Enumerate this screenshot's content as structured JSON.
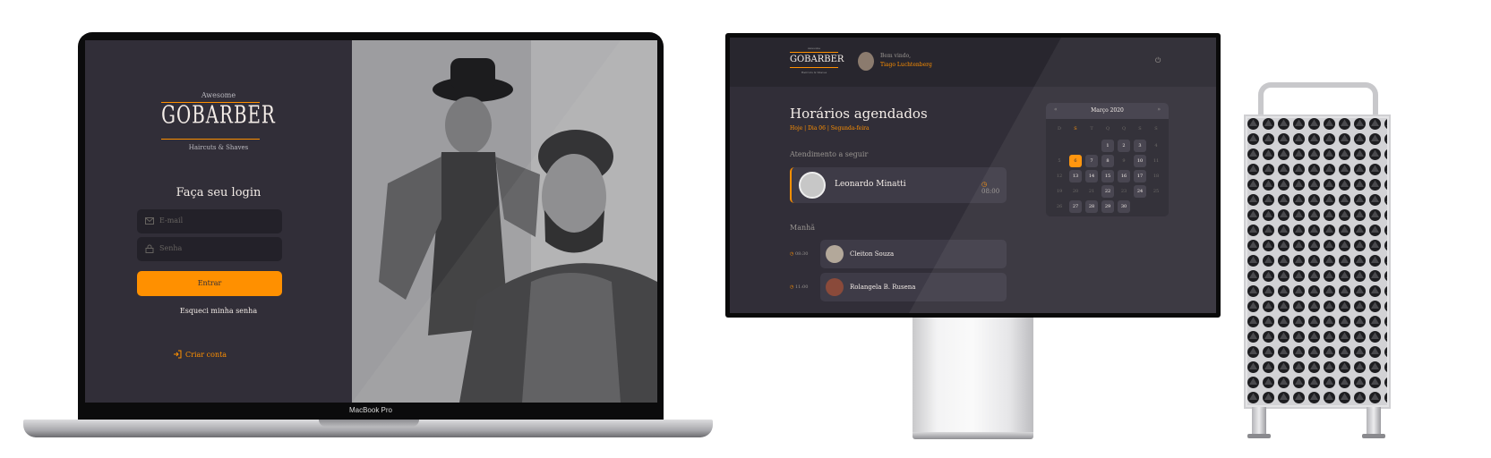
{
  "macbook": {
    "label": "MacBook Pro",
    "login": {
      "logo_top": "Awesome",
      "logo_name": "GOBARBER",
      "logo_sub": "Haircuts & Shaves",
      "title": "Faça seu login",
      "email_placeholder": "E-mail",
      "password_placeholder": "Senha",
      "submit_label": "Entrar",
      "forgot_label": "Esqueci minha senha",
      "create_label": "Criar conta"
    }
  },
  "monitor": {
    "header": {
      "logo_top": "Awesome",
      "logo_name": "GOBARBER",
      "logo_sub": "Haircuts & Shaves",
      "welcome": "Bem vindo,",
      "user_name": "Tiago Luchtenberg",
      "power_icon": "power-icon"
    },
    "title": "Horários agendados",
    "dates": "Hoje  |  Dia 06  |  Segunda-feira",
    "next_label": "Atendimento a seguir",
    "next": {
      "name": "Leonardo Minatti",
      "time": "08:00"
    },
    "morning_label": "Manhã",
    "appointments": [
      {
        "time": "08:30",
        "name": "Cleiton Souza"
      },
      {
        "time": "11:00",
        "name": "Rolangela B. Rusena"
      }
    ],
    "calendar": {
      "month": "Março 2020",
      "prev": "«",
      "next": "»",
      "weekdays": [
        "D",
        "S",
        "T",
        "Q",
        "Q",
        "S",
        "S"
      ],
      "weeks": [
        [
          "",
          "",
          "",
          "1",
          "2",
          "3",
          "4"
        ],
        [
          "5",
          "6",
          "7",
          "8",
          "9",
          "10",
          "11"
        ],
        [
          "12",
          "13",
          "14",
          "15",
          "16",
          "17",
          "18"
        ],
        [
          "19",
          "20",
          "21",
          "22",
          "23",
          "24",
          "25"
        ],
        [
          "26",
          "27",
          "28",
          "29",
          "30",
          "",
          ""
        ]
      ],
      "available": [
        "1",
        "2",
        "3",
        "7",
        "8",
        "10",
        "13",
        "14",
        "15",
        "16",
        "17",
        "22",
        "24",
        "27",
        "28",
        "29",
        "30"
      ],
      "selected": "6"
    }
  },
  "colors": {
    "accent": "#ff9000",
    "background": "#312e38",
    "surface": "#3e3b47",
    "input": "#232129",
    "text": "#f4ede8",
    "muted": "#999591"
  }
}
